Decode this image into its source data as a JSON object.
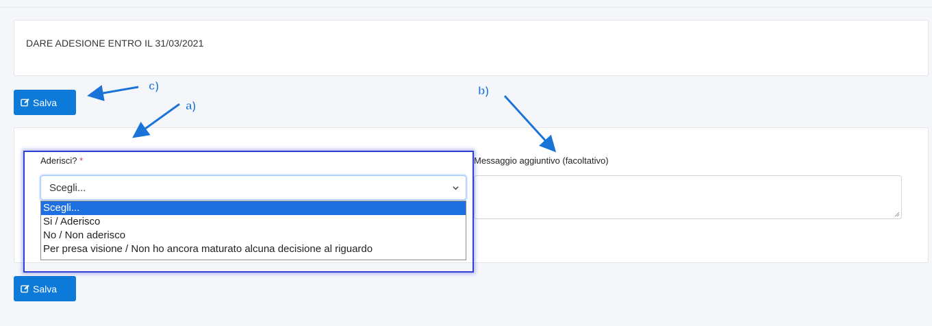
{
  "notice": {
    "text": "DARE ADESIONE ENTRO IL 31/03/2021"
  },
  "buttons": {
    "save_top": "Salva",
    "save_bottom": "Salva"
  },
  "form": {
    "aderisci_label": "Aderisci?",
    "required_mark": "*",
    "select_value": "Scegli...",
    "options": [
      "Scegli...",
      "Si / Aderisco",
      "No / Non aderisco",
      "Per presa visione / Non ho ancora maturato alcuna decisione al riguardo"
    ],
    "message_label": "Messaggio aggiuntivo (facoltativo)",
    "message_value": ""
  },
  "annotations": {
    "a": "a)",
    "b": "b)",
    "c": "c)"
  },
  "colors": {
    "primary_button": "#0d7ad9",
    "selected_option": "#1e70e0",
    "highlight_border": "#2f3fd6",
    "arrow": "#1a74d8",
    "required": "#dc3545"
  }
}
